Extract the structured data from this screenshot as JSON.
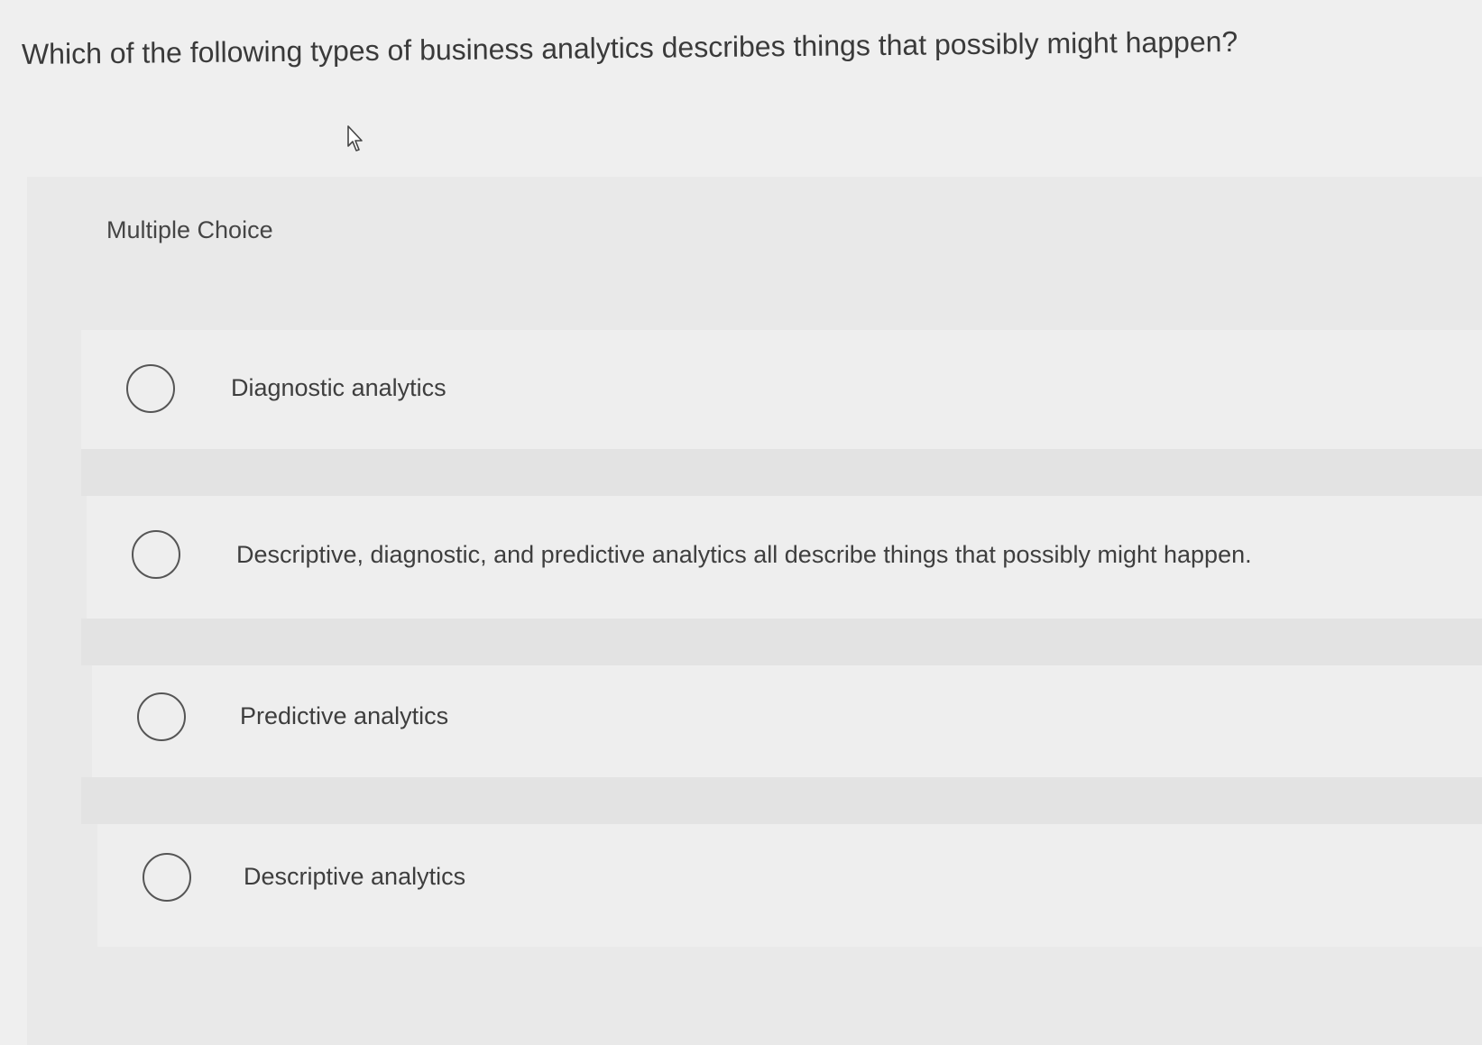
{
  "question": {
    "text": "Which of the following types of business analytics describes things that possibly might happen?"
  },
  "quiz": {
    "type_label": "Multiple Choice",
    "options": [
      {
        "label": "Diagnostic analytics",
        "selected": false
      },
      {
        "label": "Descriptive, diagnostic, and predictive analytics all describe things that possibly might happen.",
        "selected": false
      },
      {
        "label": "Predictive analytics",
        "selected": false
      },
      {
        "label": "Descriptive analytics",
        "selected": false
      }
    ]
  },
  "icons": {
    "cursor": "mouse-pointer-icon",
    "radio": "radio-unchecked-icon"
  },
  "colors": {
    "background": "#efefef",
    "panel": "#e9e9e9",
    "text": "#3b3b3b",
    "radio_border": "#555555"
  }
}
